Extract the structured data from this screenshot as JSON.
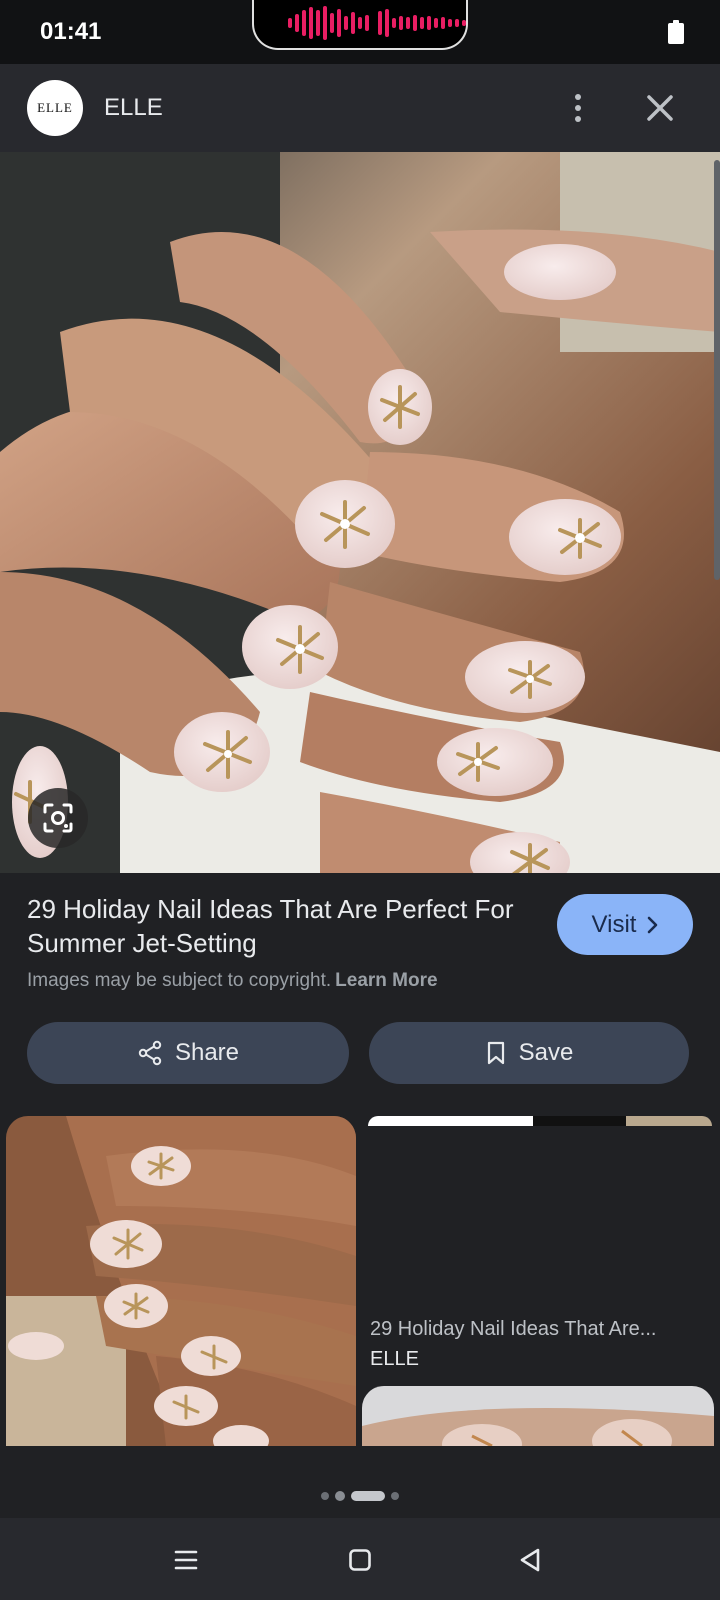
{
  "status_bar": {
    "time": "01:41"
  },
  "header": {
    "source_name": "ELLE",
    "avatar_text": "ELLE"
  },
  "result": {
    "title": "29 Holiday Nail Ideas That Are Perfect For Summer Jet-Setting",
    "visit_label": "Visit",
    "copyright_text": "Images may be subject to copyright.",
    "learn_more_label": "Learn More"
  },
  "actions": {
    "share_label": "Share",
    "save_label": "Save"
  },
  "related": {
    "items": [
      {
        "title": "29 Holiday Nail Ideas That Are...",
        "source": "ELLE"
      }
    ]
  },
  "icons": {
    "battery": "battery-icon",
    "more": "more-vert-icon",
    "close": "close-icon",
    "lens": "lens-icon",
    "share": "share-icon",
    "bookmark": "bookmark-icon",
    "chevron": "chevron-right-icon",
    "menu": "menu-icon",
    "home": "home-icon",
    "back": "back-icon"
  },
  "colors": {
    "accent": "#8ab4f8",
    "background": "#202124",
    "button": "#3c4556",
    "waveform": "#e91e63"
  }
}
